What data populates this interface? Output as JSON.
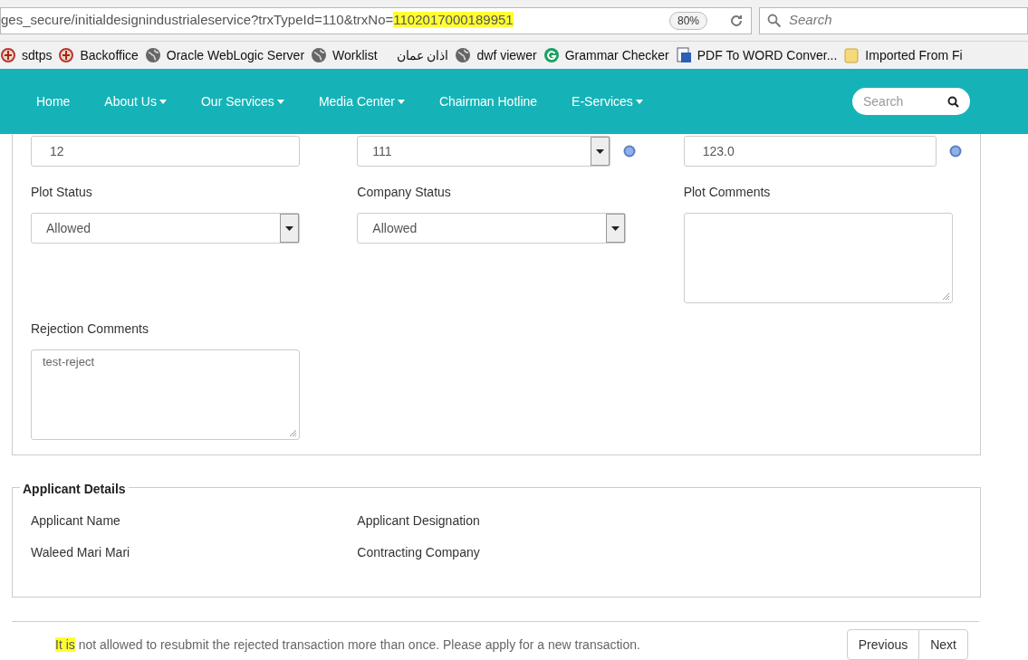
{
  "browser": {
    "url_before": "ges_secure/initialdesignindustrialeservice?trxTypeId=110&trxNo=",
    "url_highlighted": "1102017000189951",
    "zoom": "80%",
    "search_placeholder": "Search"
  },
  "bookmarks": [
    {
      "label": "sdtps",
      "kind": "emblem"
    },
    {
      "label": "Backoffice",
      "kind": "emblem"
    },
    {
      "label": "Oracle WebLogic Server",
      "kind": "globe"
    },
    {
      "label": "Worklist",
      "kind": "globe"
    },
    {
      "label": "اذان عمان",
      "kind": "none"
    },
    {
      "label": "dwf viewer",
      "kind": "globe"
    },
    {
      "label": "Grammar Checker",
      "kind": "g"
    },
    {
      "label": "PDF To WORD Conver...",
      "kind": "doc"
    },
    {
      "label": "Imported From Fi",
      "kind": "folder"
    }
  ],
  "nav": {
    "items": [
      {
        "label": "Home",
        "dropdown": false
      },
      {
        "label": "About Us",
        "dropdown": true
      },
      {
        "label": "Our Services",
        "dropdown": true
      },
      {
        "label": "Media Center",
        "dropdown": true
      },
      {
        "label": "Chairman Hotline",
        "dropdown": false
      },
      {
        "label": "E-Services",
        "dropdown": true
      }
    ],
    "search_placeholder": "Search"
  },
  "form": {
    "top_fields": [
      {
        "kind": "text",
        "value": "12",
        "help": false
      },
      {
        "kind": "select",
        "value": "111",
        "help": true
      },
      {
        "kind": "text",
        "value": "123.0",
        "help": true
      }
    ],
    "fields": [
      {
        "label": "Plot Status",
        "kind": "select",
        "value": "Allowed"
      },
      {
        "label": "Company Status",
        "kind": "select",
        "value": "Allowed"
      },
      {
        "label": "Plot Comments",
        "kind": "textarea"
      },
      {
        "label": "Rejection Comments",
        "kind": "textarea",
        "value": "test-reject"
      }
    ]
  },
  "applicant": {
    "legend": "Applicant Details",
    "columns": [
      {
        "label": "Applicant Name",
        "value": "Waleed Mari Mari"
      },
      {
        "label": "Applicant Designation",
        "value": "Contracting Company"
      }
    ]
  },
  "footer": {
    "message_highlighted": "It is",
    "message_rest": " not allowed to resubmit the rejected transaction more than once. Please apply for a new transaction.",
    "buttons": [
      "Previous",
      "Next"
    ]
  }
}
